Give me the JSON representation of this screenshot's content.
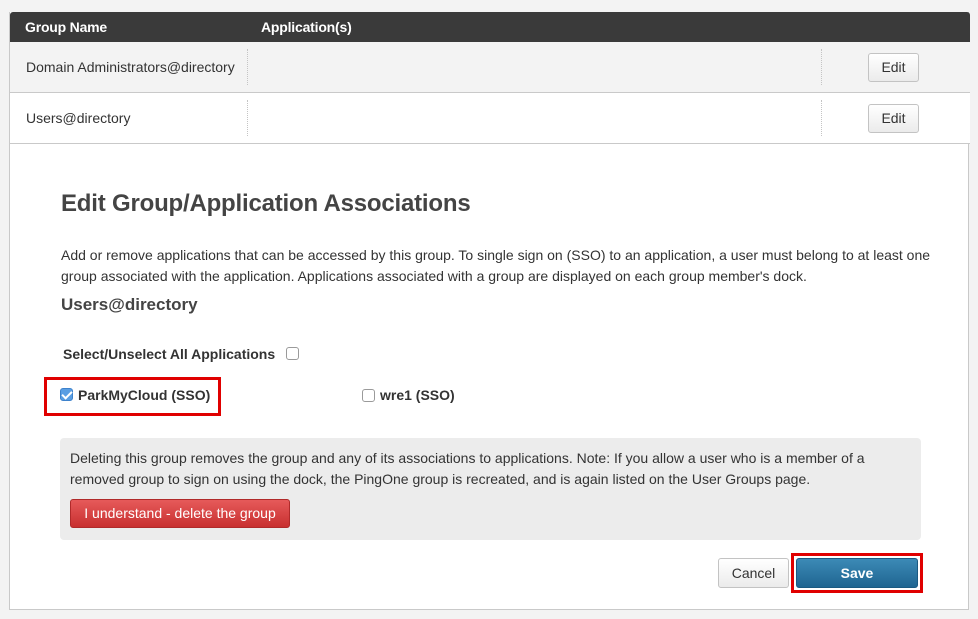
{
  "table": {
    "headers": {
      "group_name": "Group Name",
      "applications": "Application(s)"
    },
    "rows": [
      {
        "name": "Domain Administrators@directory",
        "edit_label": "Edit"
      },
      {
        "name": "Users@directory",
        "edit_label": "Edit"
      }
    ]
  },
  "panel": {
    "title": "Edit Group/Application Associations",
    "description": "Add or remove applications that can be accessed by this group. To single sign on (SSO) to an application, a user must belong to at least one group associated with the application. Applications associated with a group are displayed on each group member's dock.",
    "group_name": "Users@directory",
    "select_all_label": "Select/Unselect All Applications",
    "select_all_checked": false,
    "applications": [
      {
        "label": "ParkMyCloud (SSO)",
        "checked": true
      },
      {
        "label": "wre1 (SSO)",
        "checked": false
      }
    ],
    "warning": {
      "text": "Deleting this group removes the group and any of its associations to applications. Note: If you allow a user who is a member of a removed group to sign on using the dock, the PingOne group is recreated, and is again listed on the User Groups page.",
      "delete_button": "I understand - delete the group"
    },
    "cancel_label": "Cancel",
    "save_label": "Save"
  },
  "colors": {
    "header_bg": "#3a3a3a",
    "highlight": "#e00000",
    "save_bg": "#2a75a3",
    "delete_bg": "#d44444",
    "checkbox_checked": "#5a9ee3"
  },
  "icons": {
    "checked_checkbox": "check-icon"
  }
}
